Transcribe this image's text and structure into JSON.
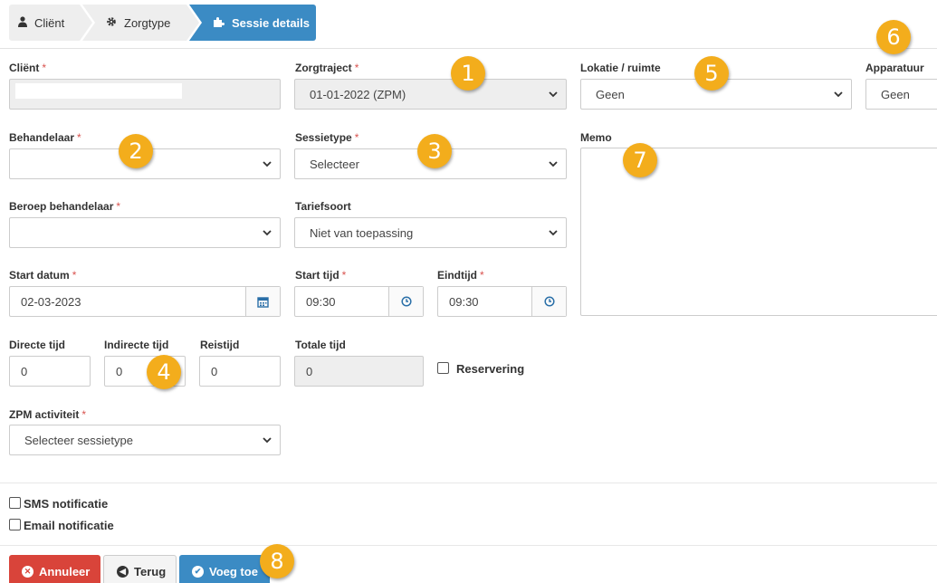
{
  "wizard": {
    "steps": [
      {
        "label": "Cliënt",
        "icon": "user-icon"
      },
      {
        "label": "Zorgtype",
        "icon": "gear-icon"
      },
      {
        "label": "Sessie details",
        "icon": "puzzle-icon"
      }
    ]
  },
  "form": {
    "client": {
      "label": "Cliënt",
      "required": "*",
      "value": ""
    },
    "zorgtraject": {
      "label": "Zorgtraject",
      "required": "*",
      "value": "01-01-2022 (ZPM)"
    },
    "lokatie": {
      "label": "Lokatie / ruimte",
      "value": "Geen"
    },
    "apparatuur": {
      "label": "Apparatuur",
      "value": "Geen"
    },
    "behandelaar": {
      "label": "Behandelaar",
      "required": "*",
      "value": ""
    },
    "sessietype": {
      "label": "Sessietype",
      "required": "*",
      "value": "Selecteer"
    },
    "memo": {
      "label": "Memo",
      "value": ""
    },
    "beroep": {
      "label": "Beroep behandelaar",
      "required": "*",
      "value": ""
    },
    "tariefsoort": {
      "label": "Tariefsoort",
      "value": "Niet van toepassing"
    },
    "start_datum": {
      "label": "Start datum",
      "required": "*",
      "value": "02-03-2023"
    },
    "start_tijd": {
      "label": "Start tijd",
      "required": "*",
      "value": "09:30"
    },
    "eindtijd": {
      "label": "Eindtijd",
      "required": "*",
      "value": "09:30"
    },
    "directe_tijd": {
      "label": "Directe tijd",
      "value": "0"
    },
    "indirecte_tijd": {
      "label": "Indirecte tijd",
      "value": "0"
    },
    "reistijd": {
      "label": "Reistijd",
      "value": "0"
    },
    "totale_tijd": {
      "label": "Totale tijd",
      "value": "0"
    },
    "reservering": {
      "label": "Reservering",
      "checked": false
    },
    "zpm_activiteit": {
      "label": "ZPM activiteit",
      "required": "*",
      "value": "Selecteer sessietype"
    }
  },
  "notifications": {
    "sms": {
      "label": "SMS notificatie",
      "checked": false
    },
    "email": {
      "label": "Email notificatie",
      "checked": false
    }
  },
  "actions": {
    "cancel": "Annuleer",
    "back": "Terug",
    "add": "Voeg toe"
  },
  "callouts": [
    "1",
    "2",
    "3",
    "4",
    "5",
    "6",
    "7",
    "8"
  ],
  "colors": {
    "accent": "#3b8bc4",
    "danger": "#d9443a",
    "callout": "#f3ad1c",
    "required": "#d9534f"
  }
}
